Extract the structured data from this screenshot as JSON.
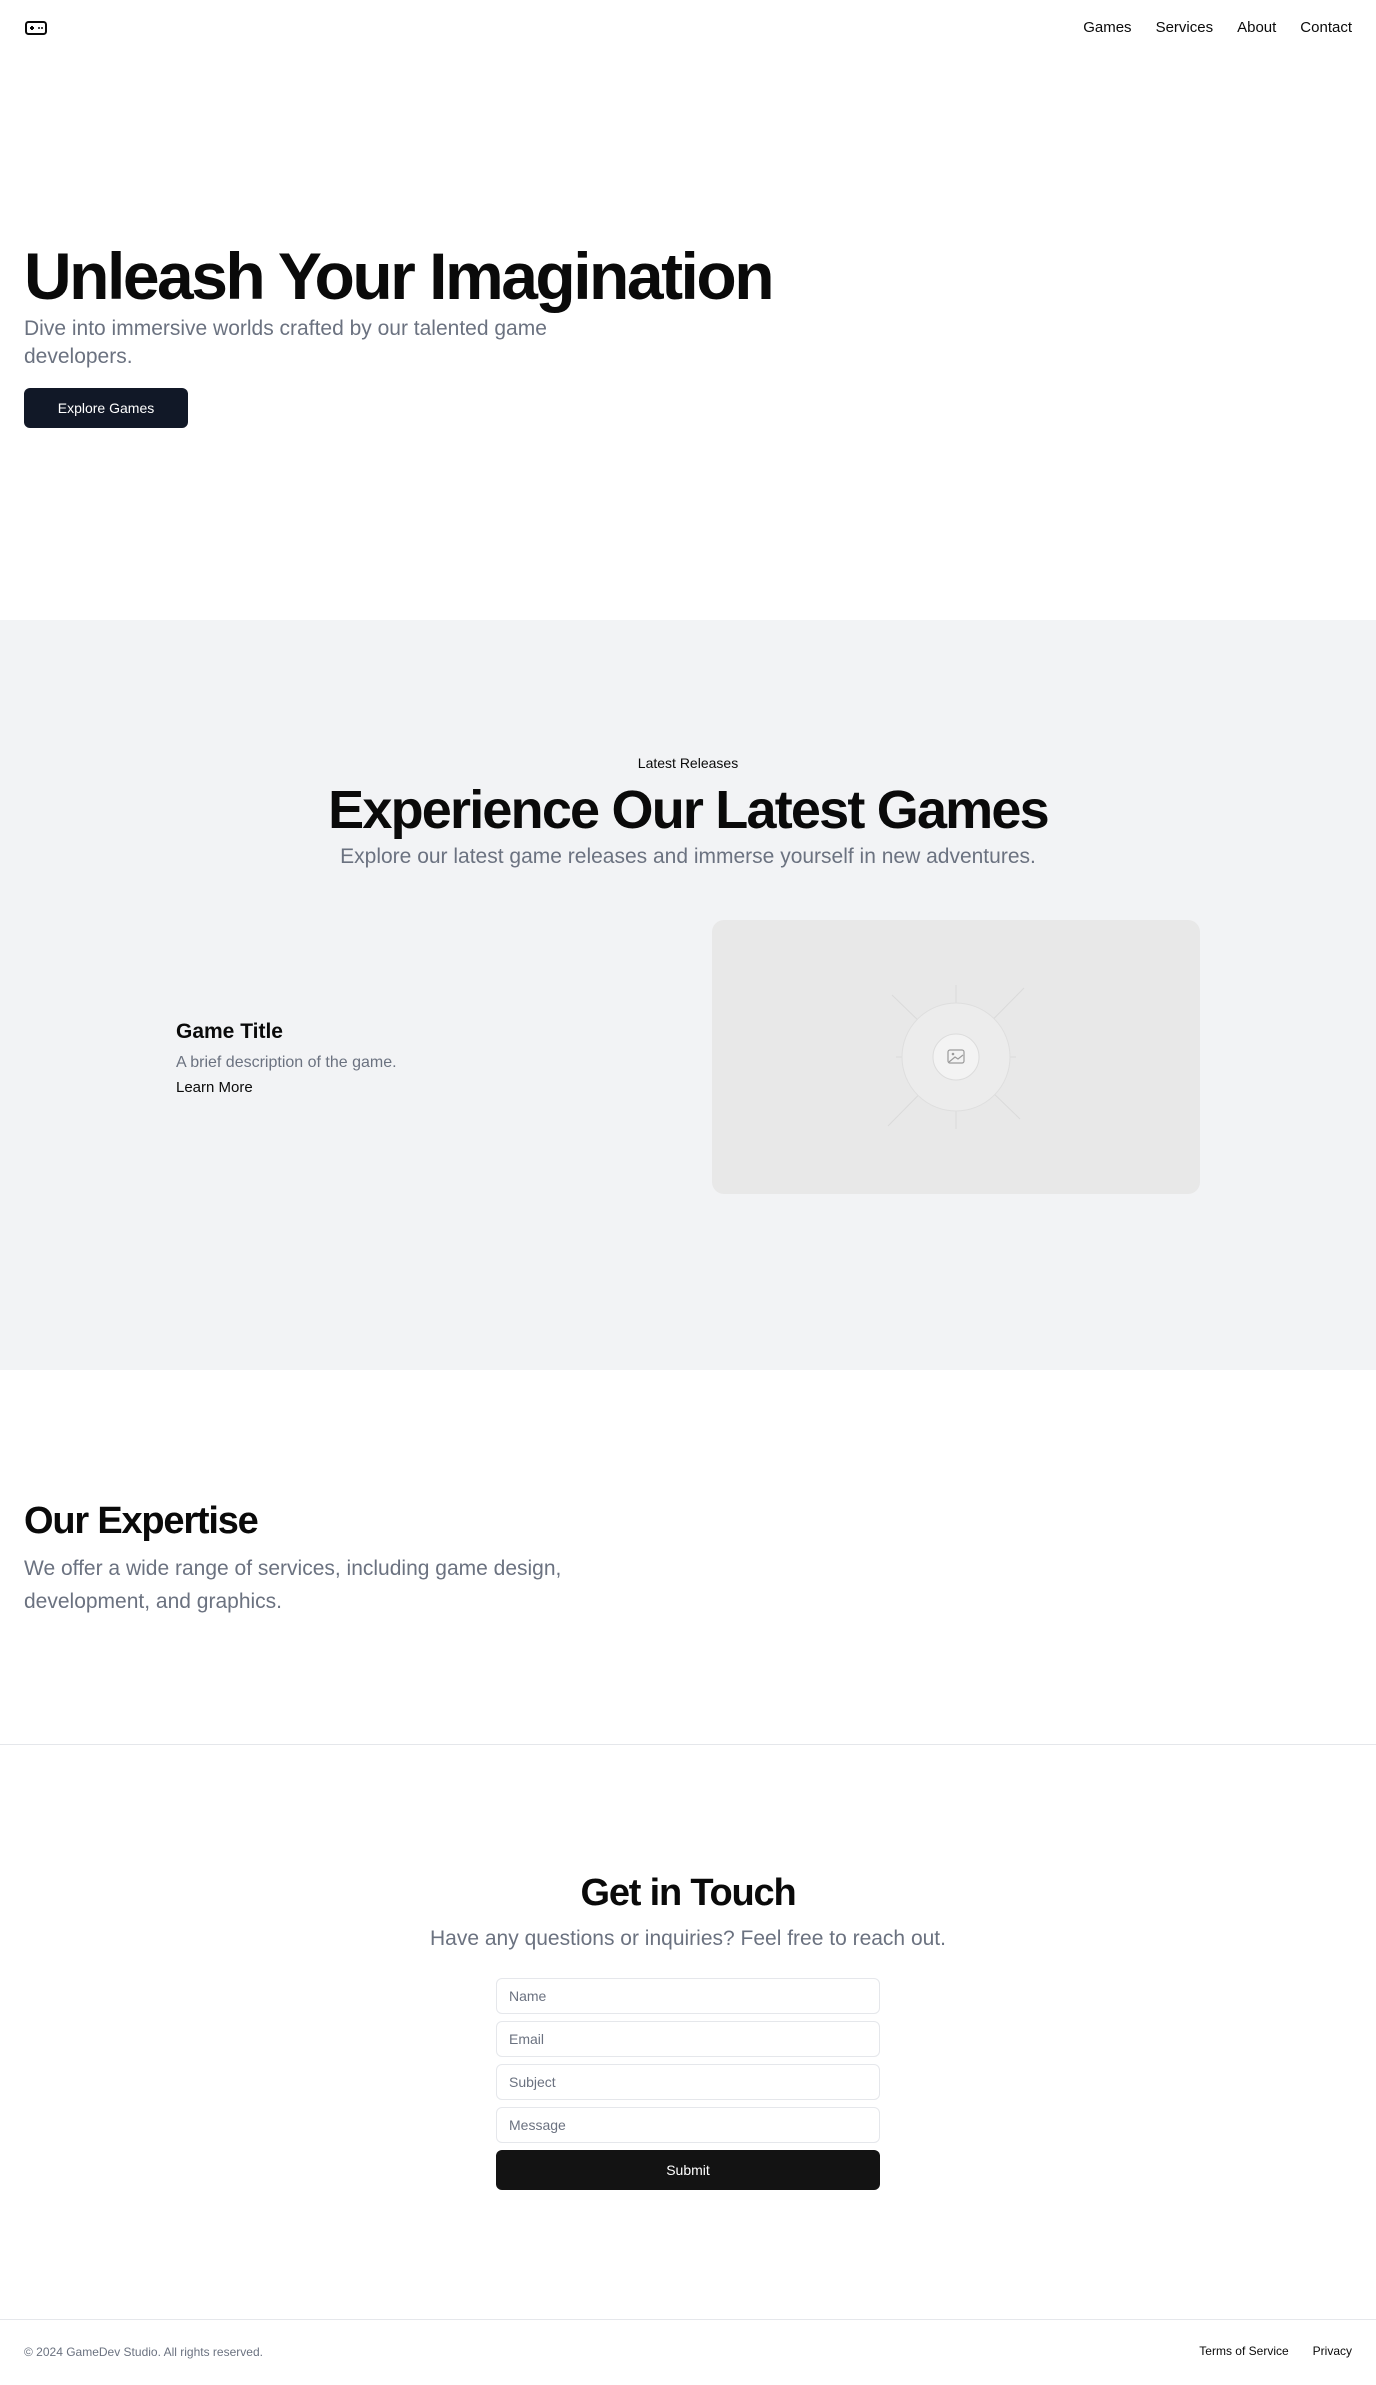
{
  "header": {
    "logo_icon": "gamepad-icon",
    "nav": [
      {
        "label": "Games"
      },
      {
        "label": "Services"
      },
      {
        "label": "About"
      },
      {
        "label": "Contact"
      }
    ]
  },
  "hero": {
    "title": "Unleash Your Imagination",
    "subtitle": "Dive into immersive worlds crafted by our talented game developers.",
    "cta_label": "Explore Games"
  },
  "games": {
    "eyebrow": "Latest Releases",
    "title": "Experience Our Latest Games",
    "subtitle": "Explore our latest game releases and immerse yourself in new adventures.",
    "card": {
      "title": "Game Title",
      "description": "A brief description of the game.",
      "link_label": "Learn More",
      "image_icon": "image-placeholder-icon"
    }
  },
  "expertise": {
    "title": "Our Expertise",
    "subtitle": "We offer a wide range of services, including game design, development, and graphics."
  },
  "contact": {
    "title": "Get in Touch",
    "subtitle": "Have any questions or inquiries? Feel free to reach out.",
    "fields": {
      "name_placeholder": "Name",
      "email_placeholder": "Email",
      "subject_placeholder": "Subject",
      "message_placeholder": "Message"
    },
    "submit_label": "Submit"
  },
  "footer": {
    "copyright": "© 2024 GameDev Studio. All rights reserved.",
    "links": [
      {
        "label": "Terms of Service"
      },
      {
        "label": "Privacy"
      }
    ]
  },
  "colors": {
    "primary_button": "#111827",
    "submit_button": "#131313",
    "muted_text": "#6b7280",
    "section_bg": "#f2f3f5"
  }
}
